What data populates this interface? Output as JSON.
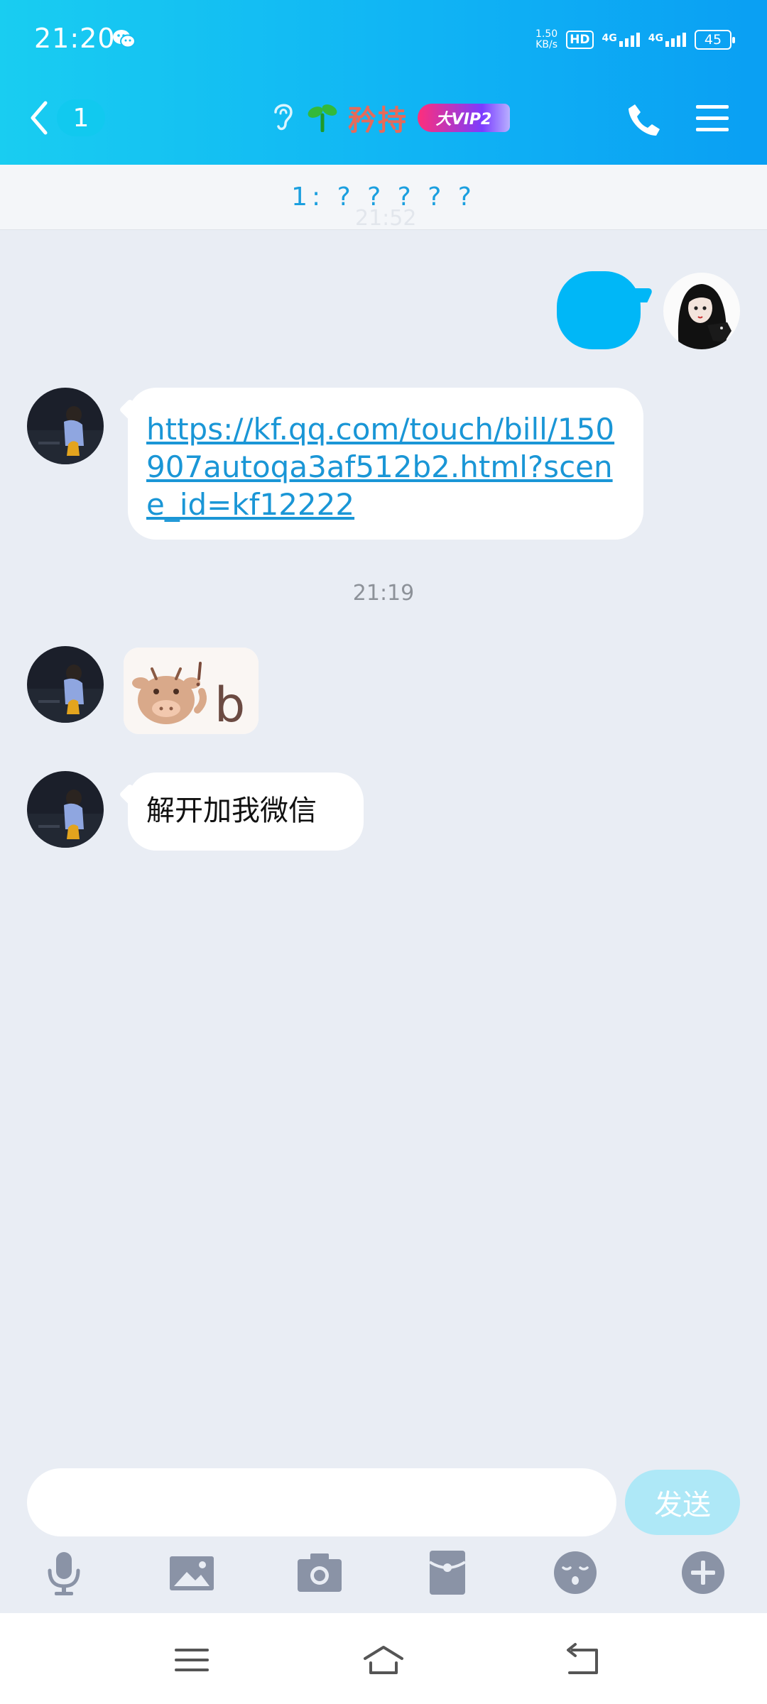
{
  "status_bar": {
    "time": "21:20",
    "net_speed_value": "1.50",
    "net_speed_unit": "KB/s",
    "hd_label": "HD",
    "sim1_label": "4G",
    "sim2_label": "4G",
    "battery": "45"
  },
  "header": {
    "unread_count": "1",
    "contact_name": "矜持",
    "vip_label": "大VIP2",
    "colors": {
      "gradient_start": "#19cdf1",
      "gradient_end": "#0a9ff3",
      "name_color": "#e66a5a"
    }
  },
  "notice": {
    "text": "1: ? ? ? ? ?",
    "ghost_time": "21:52"
  },
  "messages": [
    {
      "direction": "outgoing",
      "type": "bubble",
      "text": ""
    },
    {
      "direction": "incoming",
      "type": "link",
      "text": "https://kf.qq.com/touch/bill/150907autoqa3af512b2.html?scene_id=kf12222"
    },
    {
      "type": "time",
      "text": "21:19"
    },
    {
      "direction": "incoming",
      "type": "sticker",
      "icon": "cow-sticker",
      "sticker_text": "b"
    },
    {
      "direction": "incoming",
      "type": "text",
      "text": "解开加我微信"
    }
  ],
  "input": {
    "value": "",
    "placeholder": "",
    "send_label": "发送"
  },
  "toolbar": [
    "microphone-icon",
    "image-icon",
    "camera-icon",
    "red-packet-icon",
    "emoji-icon",
    "plus-icon"
  ],
  "accent_color": "#00b7f7"
}
